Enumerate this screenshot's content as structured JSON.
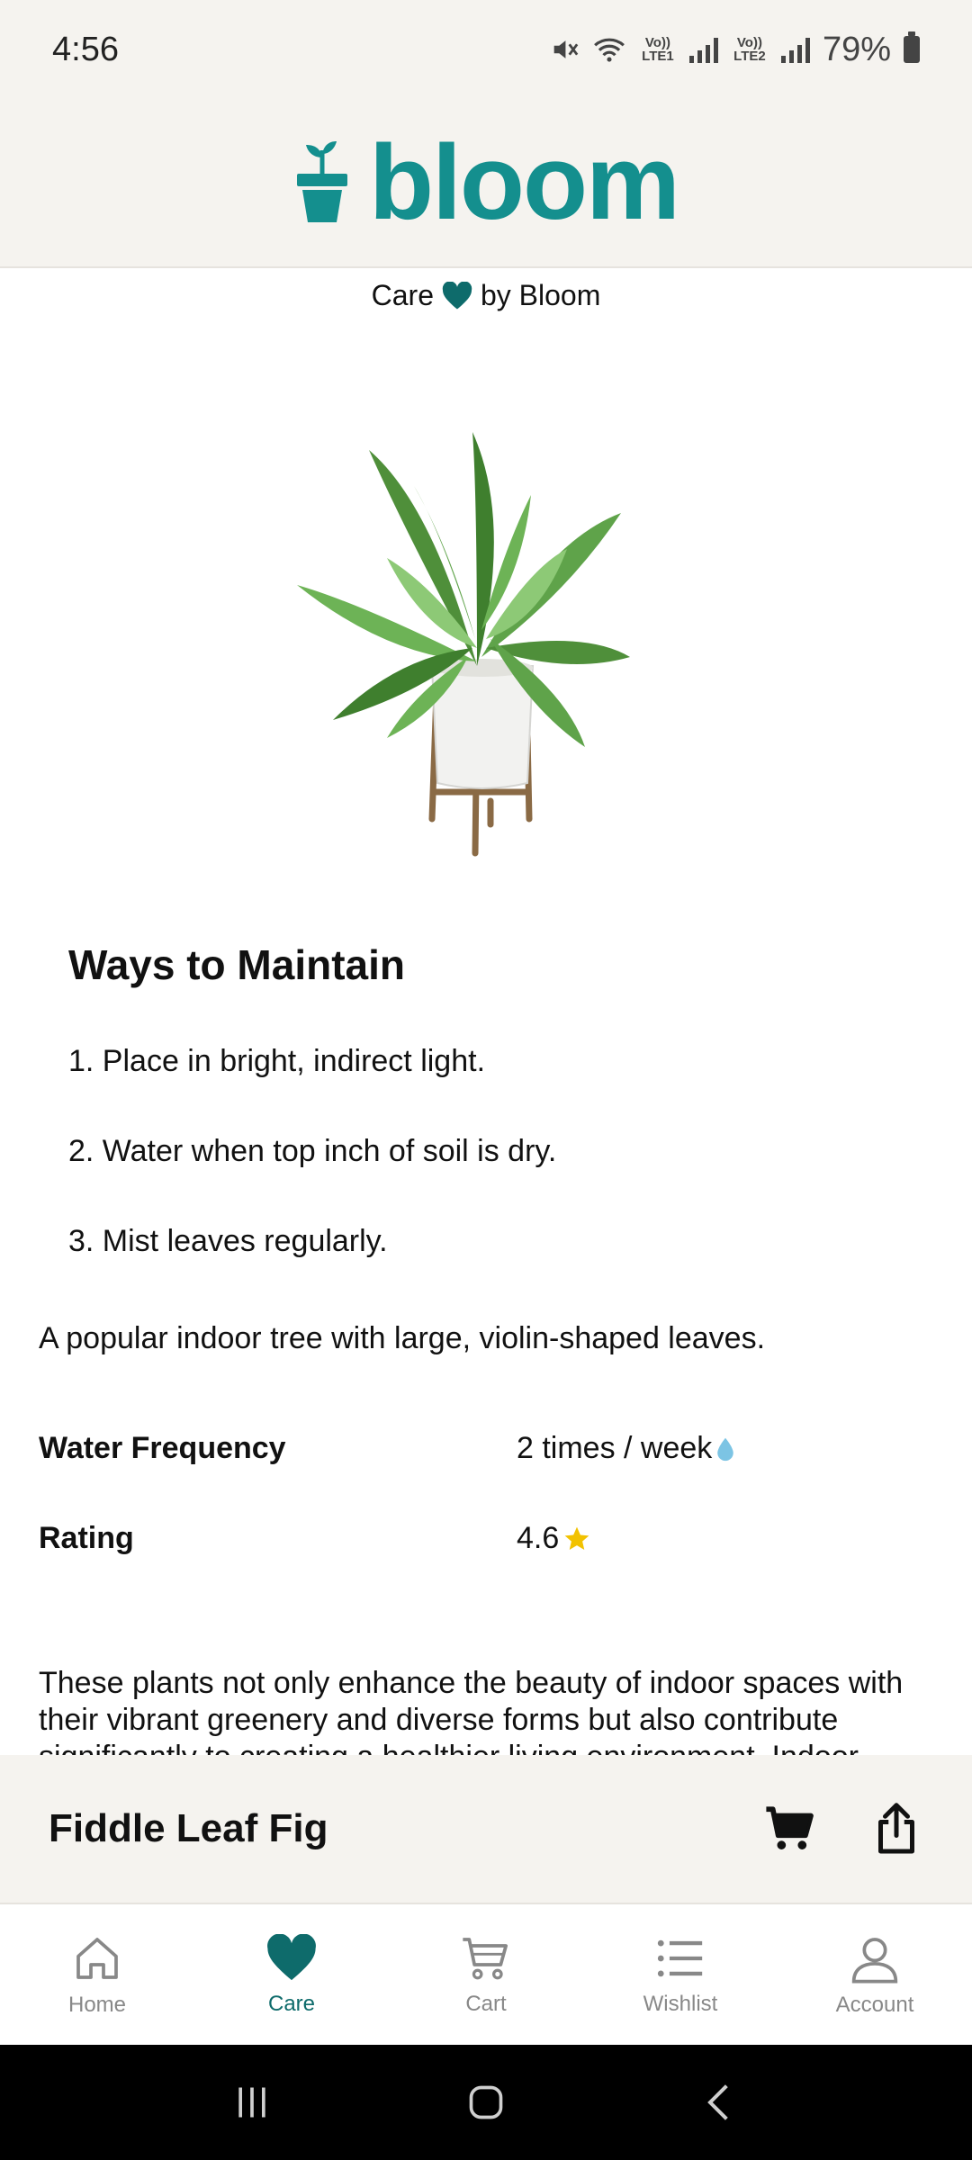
{
  "status_bar": {
    "time": "4:56",
    "battery_text": "79%",
    "sim1_label": "Vo)) LTE1",
    "sim2_label": "Vo)) LTE2"
  },
  "header": {
    "logo_text": "bloom",
    "brand_color": "#148f8e"
  },
  "tagline": {
    "prefix": "Care",
    "suffix": "by Bloom",
    "heart_icon": "heart-icon"
  },
  "care": {
    "section_title": "Ways to Maintain",
    "tips": [
      "1. Place in bright, indirect light.",
      "2. Water when top inch of soil is dry.",
      "3. Mist leaves regularly."
    ],
    "description": "A popular indoor tree with large, violin-shaped leaves.",
    "specs": {
      "water_label": "Water Frequency",
      "water_value": "2 times / week",
      "water_icon": "water-drop-icon",
      "rating_label": "Rating",
      "rating_value": "4.6",
      "rating_icon": "star-icon"
    },
    "long_text": "These plants not only enhance the beauty of indoor spaces with their vibrant greenery and diverse forms but also contribute significantly to creating a healthier living environment. Indoor"
  },
  "product": {
    "name": "Fiddle Leaf Fig",
    "cart_icon": "cart-icon",
    "share_icon": "share-icon"
  },
  "nav": {
    "items": [
      {
        "label": "Home",
        "icon": "home-icon"
      },
      {
        "label": "Care",
        "icon": "heart-icon",
        "active": true
      },
      {
        "label": "Cart",
        "icon": "cart-icon"
      },
      {
        "label": "Wishlist",
        "icon": "list-icon"
      },
      {
        "label": "Account",
        "icon": "user-icon"
      }
    ]
  },
  "colors": {
    "accent": "#0e6b6b",
    "background_beige": "#f5f3ef",
    "star": "#f2c200",
    "water_drop": "#7cc4e4"
  }
}
